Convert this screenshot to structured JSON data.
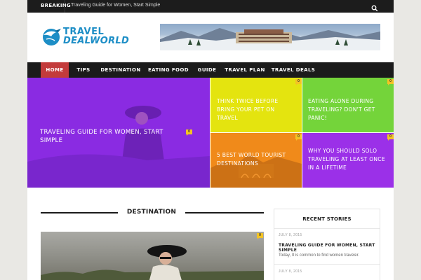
{
  "breaking": {
    "label": "BREAKING",
    "headline": "Traveling Guide for Women, Start Simple",
    "search_icon": "search-icon"
  },
  "header": {
    "logo_line1": "TRAVEL",
    "logo_line2": "DEALWORLD",
    "logo_icon": "bird-globe-icon",
    "brand_color": "#1d8ec6"
  },
  "nav": {
    "items": [
      {
        "label": "HOME",
        "active": true
      },
      {
        "label": "TIPS"
      },
      {
        "label": "DESTINATION"
      },
      {
        "label": "EATING FOOD"
      },
      {
        "label": "GUIDE"
      },
      {
        "label": "TRAVEL PLAN"
      },
      {
        "label": "TRAVEL DEALS"
      }
    ],
    "active_color": "#c33b3b"
  },
  "featured": {
    "main": {
      "title": "TRAVELING GUIDE FOR WOMEN, START SIMPLE",
      "comments": "0",
      "color": "#8a2be2"
    },
    "tiles": [
      {
        "title": "THINK TWICE BEFORE BRING YOUR PET ON TRAVEL",
        "comments": "0",
        "color": "#e4e40f"
      },
      {
        "title": "EATING ALONE DURING TRAVELING? DON'T GET PANIC!",
        "comments": "0",
        "color": "#74d43a"
      },
      {
        "title": "5 BEST WORLD TOURIST DESTINATIONS",
        "comments": "0",
        "color": "#f08a1a"
      },
      {
        "title": "WHY YOU SHOULD SOLO TRAVELING AT LEAST ONCE IN A LIFETIME",
        "comments": "0",
        "color": "#9b30e8"
      }
    ]
  },
  "destination": {
    "title": "DESTINATION",
    "comments": "0"
  },
  "recent": {
    "heading": "RECENT STORIES",
    "items": [
      {
        "date": "JULY 8, 2015",
        "title": "TRAVELING GUIDE FOR WOMEN, START SIMPLE",
        "excerpt": "Today, It is common to find women traveler."
      },
      {
        "date": "JULY 8, 2015"
      }
    ]
  }
}
